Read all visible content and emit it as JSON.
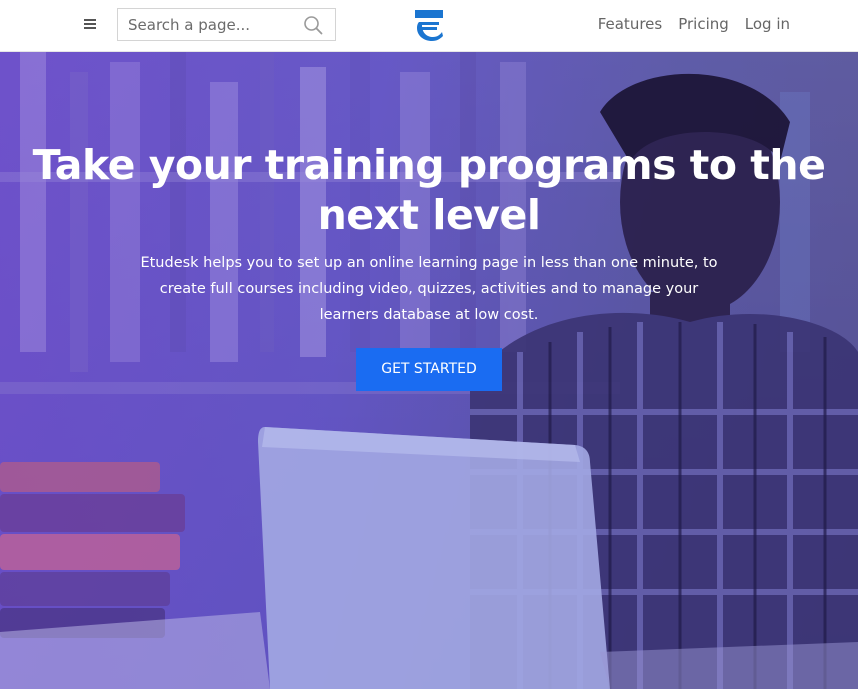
{
  "header": {
    "search": {
      "placeholder": "Search a page...",
      "value": ""
    },
    "nav": [
      {
        "label": "Features"
      },
      {
        "label": "Pricing"
      },
      {
        "label": "Log in"
      }
    ]
  },
  "hero": {
    "title": "Take your training programs to the next level",
    "subtitle": "Etudesk helps you to set up an online learning page in less than one minute, to create full courses including video, quizzes, activities and to manage your learners database at low cost.",
    "cta_label": "GET STARTED"
  },
  "colors": {
    "accent": "#1a6cf2",
    "overlay": "#6848cd",
    "logo": "#1b75d0"
  },
  "icons": [
    "menu-icon",
    "search-icon",
    "etudesk-logo-icon"
  ]
}
